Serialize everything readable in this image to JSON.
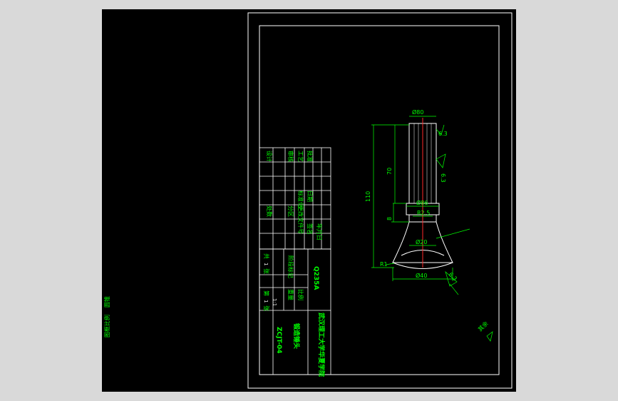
{
  "drawing": {
    "colors": {
      "background": "#000000",
      "frame": "#ffffff",
      "annotation": "#00ff00",
      "centerline": "#ff2a2a",
      "outside": "#d9d9d9"
    },
    "left_margin_text": [
      "圆锥",
      "图框比例"
    ],
    "title_block": {
      "school": "武汉理工大学华夏学院",
      "drawing_name": "锻造锤头",
      "drawing_no": "ZCJT-04",
      "material": "Q235A",
      "scale_label": "比例",
      "scale": "1:1",
      "count": "1",
      "sheet_labels": [
        "共",
        "张",
        "第",
        "张"
      ],
      "sign_rows": [
        "设计",
        "审核",
        "工艺",
        "批准",
        "标准化",
        "日期"
      ],
      "misc_labels": [
        "阶段标记",
        "重量",
        "比例",
        "处数",
        "分区",
        "更改文件号",
        "签名",
        "年月日"
      ]
    },
    "dimensions": {
      "top_dia": "Ø80",
      "mid_dia": "Ø86",
      "neck_dia": "Ø20",
      "bottom_dia": "Ø40",
      "neck_width": "R2.5",
      "length_total": "110",
      "length_shank": "70",
      "length_step": "8",
      "radius": "R1",
      "roughness_top": "6.3",
      "roughness_side": "6.3",
      "roughness_bottom": "6.3",
      "rest_note": "其余"
    }
  }
}
